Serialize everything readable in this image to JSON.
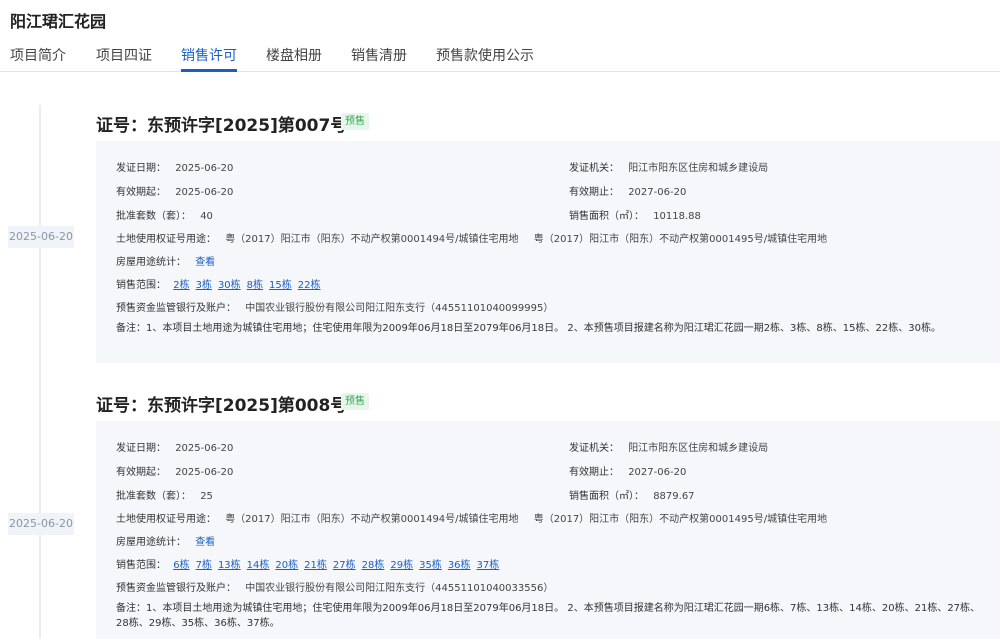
{
  "project": {
    "title": "阳江珺汇花园"
  },
  "tabs": [
    {
      "label": "项目简介"
    },
    {
      "label": "项目四证"
    },
    {
      "label": "销售许可"
    },
    {
      "label": "楼盘相册"
    },
    {
      "label": "销售清册"
    },
    {
      "label": "预售款使用公示"
    }
  ],
  "labels": {
    "issue_date": "发证日期：",
    "issuer": "发证机关：",
    "valid_from": "有效期起：",
    "valid_to": "有效期止：",
    "approved_units": "批准套数（套）：",
    "sales_area": "销售面积（㎡）：",
    "land_cert": "土地使用权证号用途：",
    "house_stats": "房屋用途统计：",
    "sales_scope": "销售范围：",
    "escrow": "预售资金监管银行及账户：",
    "note": "备注："
  },
  "view_link": "查看",
  "licenses": [
    {
      "timeline_date": "2025-06-20",
      "title": "证号：东预许字[2025]第007号",
      "badge": "预售",
      "issue_date": "2025-06-20",
      "issuer": "阳江市阳东区住房和城乡建设局",
      "valid_from": "2025-06-20",
      "valid_to": "2027-06-20",
      "approved_units": "40",
      "sales_area": "10118.88",
      "land_cert_1": "粤（2017）阳江市（阳东）不动产权第0001494号/城镇住宅用地",
      "land_cert_2": "粤（2017）阳江市（阳东）不动产权第0001495号/城镇住宅用地",
      "buildings": [
        "2栋",
        "3栋",
        "30栋",
        "8栋",
        "15栋",
        "22栋"
      ],
      "escrow": "中国农业银行股份有限公司阳江阳东支行（44551101040099995）",
      "note": "1、本项目土地用途为城镇住宅用地；住宅使用年限为2009年06月18日至2079年06月18日。 2、本预售项目报建名称为阳江珺汇花园一期2栋、3栋、8栋、15栋、22栋、30栋。"
    },
    {
      "timeline_date": "2025-06-20",
      "title": "证号：东预许字[2025]第008号",
      "badge": "预售",
      "issue_date": "2025-06-20",
      "issuer": "阳江市阳东区住房和城乡建设局",
      "valid_from": "2025-06-20",
      "valid_to": "2027-06-20",
      "approved_units": "25",
      "sales_area": "8879.67",
      "land_cert_1": "粤（2017）阳江市（阳东）不动产权第0001494号/城镇住宅用地",
      "land_cert_2": "粤（2017）阳江市（阳东）不动产权第0001495号/城镇住宅用地",
      "buildings": [
        "6栋",
        "7栋",
        "13栋",
        "14栋",
        "20栋",
        "21栋",
        "27栋",
        "28栋",
        "29栋",
        "35栋",
        "36栋",
        "37栋"
      ],
      "escrow": "中国农业银行股份有限公司阳江阳东支行（44551101040033556）",
      "note": "1、本项目土地用途为城镇住宅用地；住宅使用年限为2009年06月18日至2079年06月18日。 2、本预售项目报建名称为阳江珺汇花园一期6栋、7栋、13栋、14栋、20栋、21栋、27栋、28栋、29栋、35栋、36栋、37栋。"
    }
  ]
}
